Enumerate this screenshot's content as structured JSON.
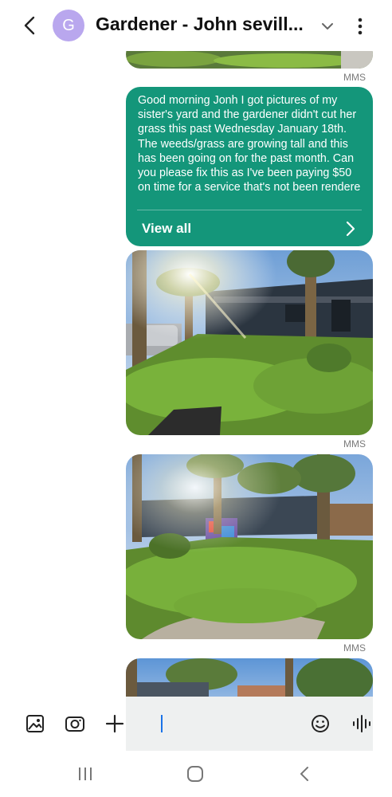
{
  "header": {
    "avatar_letter": "G",
    "contact_name": "Gardener - John sevill...",
    "icons": [
      "back-arrow-icon",
      "chevron-down-icon",
      "more-vertical-icon"
    ]
  },
  "messages": [
    {
      "type": "image",
      "label": "MMS"
    },
    {
      "type": "text",
      "body": "Good morning Jonh I got pictures of my sister's yard and the gardener didn't cut her grass this past Wednesday January 18th.  The weeds/grass are growing tall and this has been going on for the past month.  Can you please fix this as I've been paying $50 on time for a service that's not been rendere",
      "action": "View all"
    },
    {
      "type": "image",
      "label": "MMS"
    },
    {
      "type": "image",
      "label": "MMS"
    },
    {
      "type": "image",
      "label": ""
    }
  ],
  "composer": {
    "icons": [
      "gallery-icon",
      "camera-icon",
      "plus-icon",
      "emoji-icon",
      "voice-icon"
    ],
    "input_value": ""
  },
  "navbar": {
    "icons": [
      "recent-apps-icon",
      "home-icon",
      "back-icon"
    ]
  },
  "colors": {
    "bubble": "#14967a",
    "avatar": "#b9a7ee",
    "input_bg": "#eef0f0"
  }
}
